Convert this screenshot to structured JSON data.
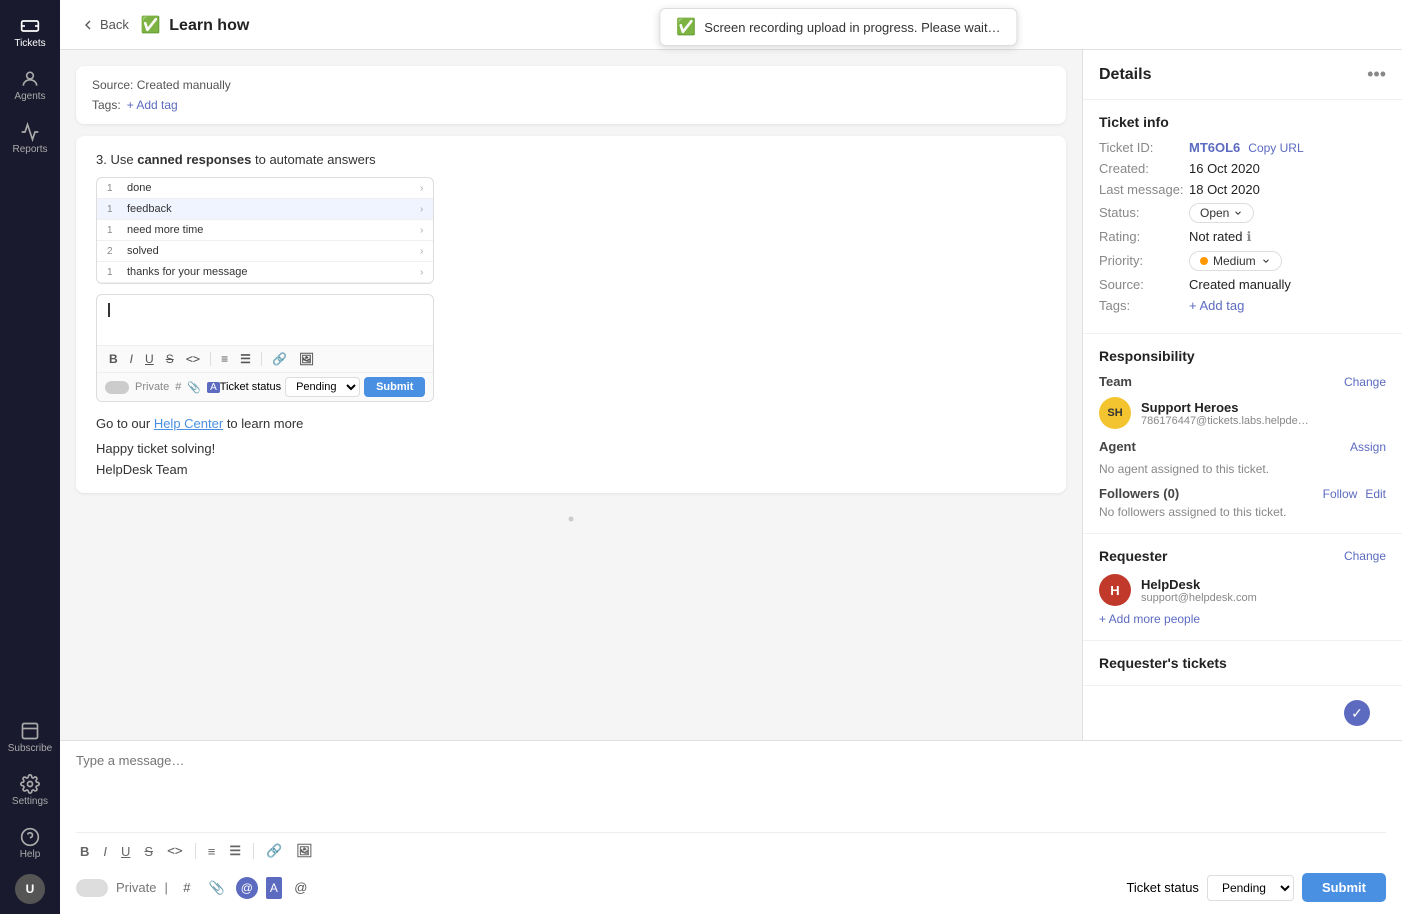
{
  "sidebar": {
    "items": [
      {
        "id": "tickets",
        "label": "Tickets",
        "icon": "ticket-icon",
        "active": true
      },
      {
        "id": "agents",
        "label": "Agents",
        "icon": "agents-icon",
        "active": false
      },
      {
        "id": "reports",
        "label": "Reports",
        "icon": "reports-icon",
        "active": false
      }
    ],
    "bottom": [
      {
        "id": "subscribe",
        "label": "Subscribe",
        "icon": "subscribe-icon"
      },
      {
        "id": "settings",
        "label": "Settings",
        "icon": "settings-icon"
      },
      {
        "id": "help",
        "label": "Help",
        "icon": "help-icon"
      }
    ],
    "avatar": {
      "initials": "U"
    }
  },
  "topbar": {
    "back_label": "Back",
    "title": "Learn how",
    "title_emoji": "✅",
    "toast": "Screen recording upload in progress. Please wait…",
    "toast_icon": "✅"
  },
  "thread": {
    "source_card": {
      "source_label": "Source:",
      "source_value": "Created manually",
      "tags_label": "Tags:",
      "add_tag": "+ Add tag"
    },
    "step3": {
      "number": "3.",
      "text": "Use",
      "bold": "canned responses",
      "text2": "to automate answers"
    },
    "canned_items": [
      {
        "count": "1",
        "label": "done",
        "has_arrow": true,
        "highlighted": false
      },
      {
        "count": "1",
        "label": "feedback",
        "has_arrow": true,
        "highlighted": true
      },
      {
        "count": "1",
        "label": "need more time",
        "has_arrow": true,
        "highlighted": false
      },
      {
        "count": "2",
        "label": "solved",
        "has_arrow": true,
        "highlighted": false
      },
      {
        "count": "1",
        "label": "thanks for your message",
        "has_arrow": true,
        "highlighted": false
      }
    ],
    "mini_editor": {
      "cursor": "#",
      "toolbar": [
        "B",
        "I",
        "U",
        "S",
        "<>",
        "|",
        "OL",
        "UL",
        "|",
        "🔗",
        "🖼"
      ],
      "private_label": "Private",
      "ticket_status_label": "Ticket status",
      "status_value": "Pending",
      "submit_label": "Submit"
    },
    "help_text_pre": "Go to our ",
    "help_link": "Help Center",
    "help_text_post": " to learn more",
    "happy_text": "Happy ticket solving!",
    "team_text": "HelpDesk Team",
    "divider": "•"
  },
  "compose": {
    "placeholder": "Type a message…",
    "toolbar_buttons": [
      "B",
      "I",
      "U",
      "S",
      "<>",
      "|",
      "OL",
      "UL",
      "|",
      "🔗",
      "🖼"
    ],
    "private_label": "Private",
    "ticket_status_label": "Ticket status",
    "status_options": [
      "Pending"
    ],
    "status_value": "Pending",
    "submit_label": "Submit",
    "check_icon": "✓"
  },
  "details": {
    "panel_title": "Details",
    "more_icon": "•••",
    "ticket_info": {
      "section_title": "Ticket info",
      "ticket_id_label": "Ticket ID:",
      "ticket_id_value": "MT6OL6",
      "copy_url_label": "Copy URL",
      "created_label": "Created:",
      "created_value": "16 Oct 2020",
      "last_message_label": "Last message:",
      "last_message_value": "18 Oct 2020",
      "status_label": "Status:",
      "status_value": "Open",
      "rating_label": "Rating:",
      "rating_value": "Not rated",
      "priority_label": "Priority:",
      "priority_value": "Medium",
      "source_label": "Source:",
      "source_value": "Created manually",
      "tags_label": "Tags:",
      "add_tag": "+ Add tag"
    },
    "responsibility": {
      "section_title": "Responsibility",
      "team_label": "Team",
      "change_label": "Change",
      "team_name": "Support Heroes",
      "team_email": "786176447@tickets.labs.helpde…",
      "team_initials": "SH",
      "agent_label": "Agent",
      "assign_label": "Assign",
      "no_agent": "No agent assigned to this ticket.",
      "followers_label": "Followers (0)",
      "follow_label": "Follow",
      "edit_label": "Edit",
      "no_followers": "No followers assigned to this ticket."
    },
    "requester": {
      "section_title": "Requester",
      "change_label": "Change",
      "name": "HelpDesk",
      "email": "support@helpdesk.com",
      "initials": "H",
      "add_people": "+ Add more people"
    },
    "requester_tickets": {
      "section_title": "Requester's tickets"
    }
  }
}
